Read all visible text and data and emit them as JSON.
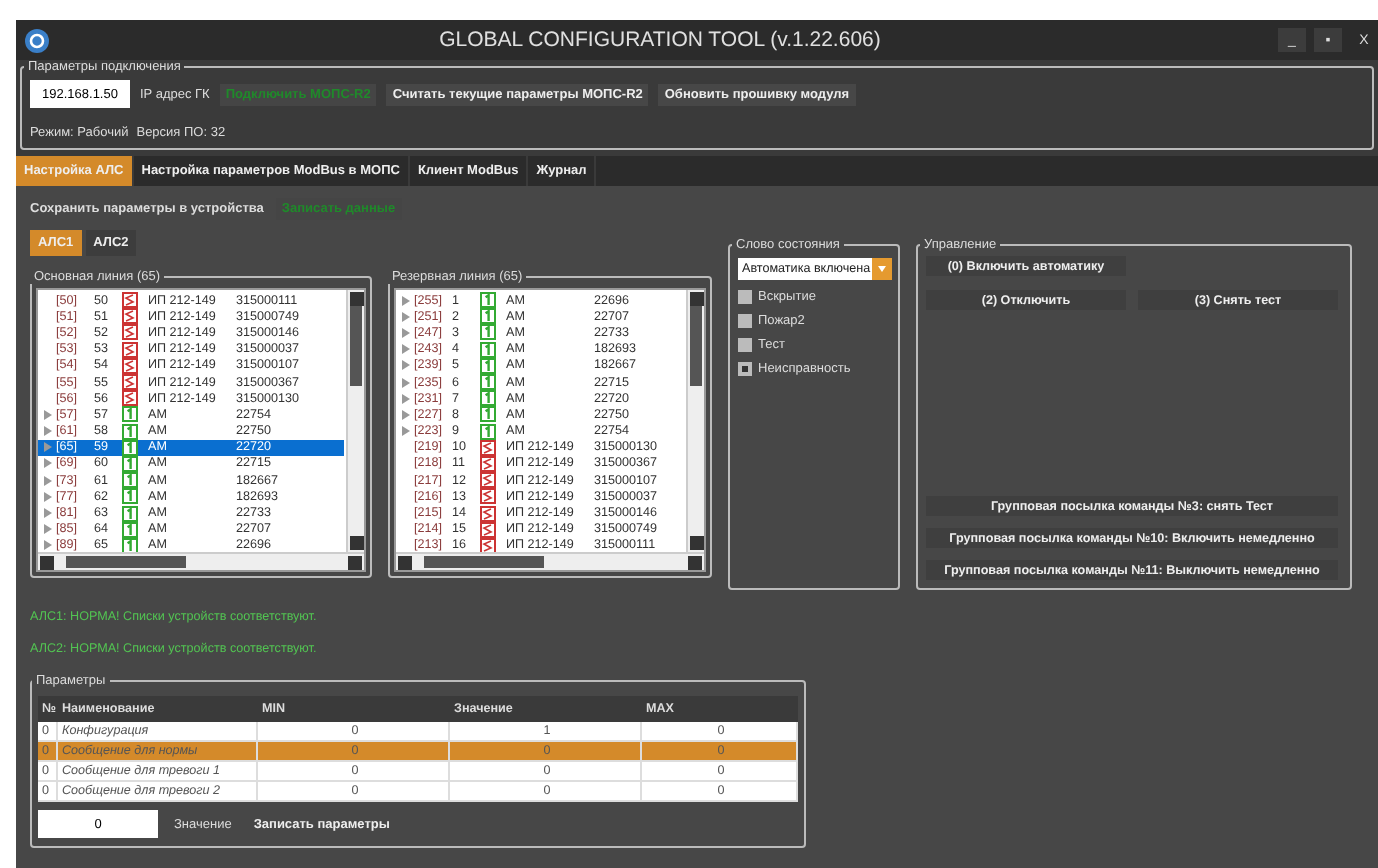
{
  "window": {
    "title": "GLOBAL CONFIGURATION TOOL (v.1.22.606)",
    "controls": [
      "_",
      "▪",
      "X"
    ]
  },
  "connection": {
    "legend": "Параметры подключения",
    "ip": "192.168.1.50",
    "ip_label": "IP адрес ГК",
    "buttons": [
      {
        "label": "Подключить МОПС-R2",
        "kind": "green"
      },
      {
        "label": "Считать текущие параметры МОПС-R2",
        "kind": "plain"
      },
      {
        "label": "Обновить прошивку модуля",
        "kind": "plain"
      }
    ],
    "mode": "Режим: Рабочий",
    "version": "Версия ПО: 32"
  },
  "tabs": [
    {
      "label": "Настройка АЛС",
      "selected": true
    },
    {
      "label": "Настройка параметров ModBus в МОПС",
      "selected": false
    },
    {
      "label": "Клиент ModBus",
      "selected": false
    },
    {
      "label": "Журнал",
      "selected": false
    }
  ],
  "save": {
    "label": "Сохранить параметры в устройства",
    "button": "Записать данные"
  },
  "als_tabs": [
    {
      "label": "АЛС1",
      "selected": true
    },
    {
      "label": "АЛС2",
      "selected": false
    }
  ],
  "lists": [
    {
      "legend": "Основная линия (65)",
      "rows": [
        {
          "addr": "[50]",
          "num": "50",
          "kind": "ip",
          "name": "ИП 212-149",
          "serial": "315000111",
          "expandable": false,
          "selected": false
        },
        {
          "addr": "[51]",
          "num": "51",
          "kind": "ip",
          "name": "ИП 212-149",
          "serial": "315000749",
          "expandable": false,
          "selected": false
        },
        {
          "addr": "[52]",
          "num": "52",
          "kind": "ip",
          "name": "ИП 212-149",
          "serial": "315000146",
          "expandable": false,
          "selected": false
        },
        {
          "addr": "[53]",
          "num": "53",
          "kind": "ip",
          "name": "ИП 212-149",
          "serial": "315000037",
          "expandable": false,
          "selected": false
        },
        {
          "addr": "[54]",
          "num": "54",
          "kind": "ip",
          "name": "ИП 212-149",
          "serial": "315000107",
          "expandable": false,
          "selected": false
        },
        {
          "addr": "[55]",
          "num": "55",
          "kind": "ip",
          "name": "ИП 212-149",
          "serial": "315000367",
          "expandable": false,
          "selected": false
        },
        {
          "addr": "[56]",
          "num": "56",
          "kind": "ip",
          "name": "ИП 212-149",
          "serial": "315000130",
          "expandable": false,
          "selected": false
        },
        {
          "addr": "[57]",
          "num": "57",
          "kind": "am",
          "name": "АМ",
          "serial": "22754",
          "expandable": true,
          "selected": false
        },
        {
          "addr": "[61]",
          "num": "58",
          "kind": "am",
          "name": "АМ",
          "serial": "22750",
          "expandable": true,
          "selected": false
        },
        {
          "addr": "[65]",
          "num": "59",
          "kind": "am",
          "name": "АМ",
          "serial": "22720",
          "expandable": true,
          "selected": true
        },
        {
          "addr": "[69]",
          "num": "60",
          "kind": "am",
          "name": "АМ",
          "serial": "22715",
          "expandable": true,
          "selected": false
        },
        {
          "addr": "[73]",
          "num": "61",
          "kind": "am",
          "name": "АМ",
          "serial": "182667",
          "expandable": true,
          "selected": false
        },
        {
          "addr": "[77]",
          "num": "62",
          "kind": "am",
          "name": "АМ",
          "serial": "182693",
          "expandable": true,
          "selected": false
        },
        {
          "addr": "[81]",
          "num": "63",
          "kind": "am",
          "name": "АМ",
          "serial": "22733",
          "expandable": true,
          "selected": false
        },
        {
          "addr": "[85]",
          "num": "64",
          "kind": "am",
          "name": "АМ",
          "serial": "22707",
          "expandable": true,
          "selected": false
        },
        {
          "addr": "[89]",
          "num": "65",
          "kind": "am",
          "name": "АМ",
          "serial": "22696",
          "expandable": true,
          "selected": false
        }
      ]
    },
    {
      "legend": "Резервная линия (65)",
      "rows": [
        {
          "addr": "[255]",
          "num": "1",
          "kind": "am",
          "name": "АМ",
          "serial": "22696",
          "expandable": true,
          "selected": false
        },
        {
          "addr": "[251]",
          "num": "2",
          "kind": "am",
          "name": "АМ",
          "serial": "22707",
          "expandable": true,
          "selected": false
        },
        {
          "addr": "[247]",
          "num": "3",
          "kind": "am",
          "name": "АМ",
          "serial": "22733",
          "expandable": true,
          "selected": false
        },
        {
          "addr": "[243]",
          "num": "4",
          "kind": "am",
          "name": "АМ",
          "serial": "182693",
          "expandable": true,
          "selected": false
        },
        {
          "addr": "[239]",
          "num": "5",
          "kind": "am",
          "name": "АМ",
          "serial": "182667",
          "expandable": true,
          "selected": false
        },
        {
          "addr": "[235]",
          "num": "6",
          "kind": "am",
          "name": "АМ",
          "serial": "22715",
          "expandable": true,
          "selected": false
        },
        {
          "addr": "[231]",
          "num": "7",
          "kind": "am",
          "name": "АМ",
          "serial": "22720",
          "expandable": true,
          "selected": false
        },
        {
          "addr": "[227]",
          "num": "8",
          "kind": "am",
          "name": "АМ",
          "serial": "22750",
          "expandable": true,
          "selected": false
        },
        {
          "addr": "[223]",
          "num": "9",
          "kind": "am",
          "name": "АМ",
          "serial": "22754",
          "expandable": true,
          "selected": false
        },
        {
          "addr": "[219]",
          "num": "10",
          "kind": "ip",
          "name": "ИП 212-149",
          "serial": "315000130",
          "expandable": false,
          "selected": false
        },
        {
          "addr": "[218]",
          "num": "11",
          "kind": "ip",
          "name": "ИП 212-149",
          "serial": "315000367",
          "expandable": false,
          "selected": false
        },
        {
          "addr": "[217]",
          "num": "12",
          "kind": "ip",
          "name": "ИП 212-149",
          "serial": "315000107",
          "expandable": false,
          "selected": false
        },
        {
          "addr": "[216]",
          "num": "13",
          "kind": "ip",
          "name": "ИП 212-149",
          "serial": "315000037",
          "expandable": false,
          "selected": false
        },
        {
          "addr": "[215]",
          "num": "14",
          "kind": "ip",
          "name": "ИП 212-149",
          "serial": "315000146",
          "expandable": false,
          "selected": false
        },
        {
          "addr": "[214]",
          "num": "15",
          "kind": "ip",
          "name": "ИП 212-149",
          "serial": "315000749",
          "expandable": false,
          "selected": false
        },
        {
          "addr": "[213]",
          "num": "16",
          "kind": "ip",
          "name": "ИП 212-149",
          "serial": "315000111",
          "expandable": false,
          "selected": false
        }
      ]
    }
  ],
  "status_word": {
    "legend": "Слово состояния",
    "dropdown": "Автоматика включена",
    "flags": [
      {
        "label": "Вскрытие",
        "checked": false
      },
      {
        "label": "Пожар2",
        "checked": false
      },
      {
        "label": "Тест",
        "checked": false
      },
      {
        "label": "Неисправность",
        "checked": true
      }
    ]
  },
  "control": {
    "legend": "Управление",
    "top_buttons": [
      "(0) Включить автоматику"
    ],
    "pair_buttons": [
      "(2) Отключить",
      "(3) Снять тест"
    ],
    "group_buttons": [
      "Групповая посылка команды №3: снять Тест",
      "Групповая посылка команды №10: Включить немедленно",
      "Групповая посылка команды №11: Выключить немедленно"
    ]
  },
  "messages": [
    "АЛС1: НОРМА! Списки устройств соответствуют.",
    "АЛС2: НОРМА! Списки устройств соответствуют."
  ],
  "parameters": {
    "legend": "Параметры",
    "columns": [
      "№",
      "Наименование",
      "MIN",
      "Значение",
      "MAX"
    ],
    "rows": [
      {
        "cells": [
          "0",
          "Конфигурация",
          "0",
          "1",
          "0"
        ],
        "selected": false
      },
      {
        "cells": [
          "0",
          "Сообщение для нормы",
          "0",
          "0",
          "0"
        ],
        "selected": true
      },
      {
        "cells": [
          "0",
          "Сообщение для тревоги 1",
          "0",
          "0",
          "0"
        ],
        "selected": false
      },
      {
        "cells": [
          "0",
          "Сообщение для тревоги 2",
          "0",
          "0",
          "0"
        ],
        "selected": false
      }
    ],
    "value": "0",
    "value_label": "Значение",
    "write_button": "Записать параметры"
  }
}
